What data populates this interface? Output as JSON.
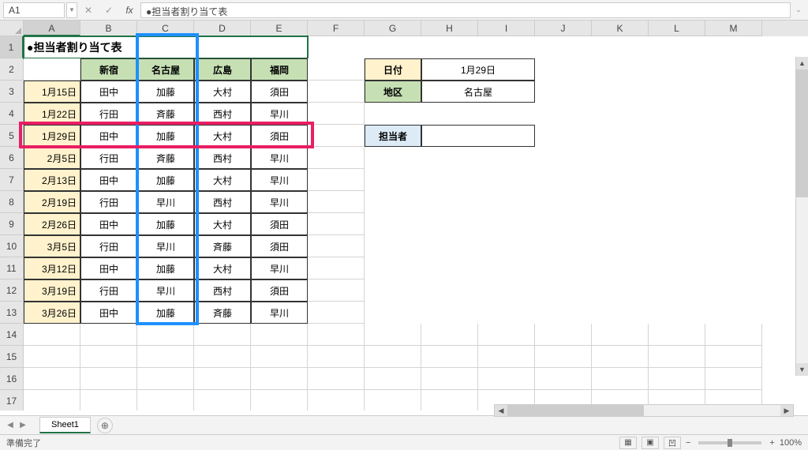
{
  "formula_bar": {
    "cell_ref": "A1",
    "formula": "●担当者割り当て表"
  },
  "columns": [
    "A",
    "B",
    "C",
    "D",
    "E",
    "F",
    "G",
    "H",
    "I",
    "J",
    "K",
    "L",
    "M"
  ],
  "rows_visible": 17,
  "title": "●担当者割り当て表",
  "headers": [
    "新宿",
    "名古屋",
    "広島",
    "福岡"
  ],
  "table": [
    {
      "date": "1月15日",
      "v": [
        "田中",
        "加藤",
        "大村",
        "須田"
      ]
    },
    {
      "date": "1月22日",
      "v": [
        "行田",
        "斉藤",
        "西村",
        "早川"
      ]
    },
    {
      "date": "1月29日",
      "v": [
        "田中",
        "加藤",
        "大村",
        "須田"
      ]
    },
    {
      "date": "2月5日",
      "v": [
        "行田",
        "斉藤",
        "西村",
        "早川"
      ]
    },
    {
      "date": "2月13日",
      "v": [
        "田中",
        "加藤",
        "大村",
        "早川"
      ]
    },
    {
      "date": "2月19日",
      "v": [
        "行田",
        "早川",
        "西村",
        "早川"
      ]
    },
    {
      "date": "2月26日",
      "v": [
        "田中",
        "加藤",
        "大村",
        "須田"
      ]
    },
    {
      "date": "3月5日",
      "v": [
        "行田",
        "早川",
        "斉藤",
        "須田"
      ]
    },
    {
      "date": "3月12日",
      "v": [
        "田中",
        "加藤",
        "大村",
        "早川"
      ]
    },
    {
      "date": "3月19日",
      "v": [
        "行田",
        "早川",
        "西村",
        "須田"
      ]
    },
    {
      "date": "3月26日",
      "v": [
        "田中",
        "加藤",
        "斉藤",
        "早川"
      ]
    }
  ],
  "lookup": {
    "date_label": "日付",
    "date_value": "1月29日",
    "area_label": "地区",
    "area_value": "名古屋",
    "person_label": "担当者",
    "person_value": ""
  },
  "sheet_tab": "Sheet1",
  "status": "準備完了",
  "zoom": "100%"
}
